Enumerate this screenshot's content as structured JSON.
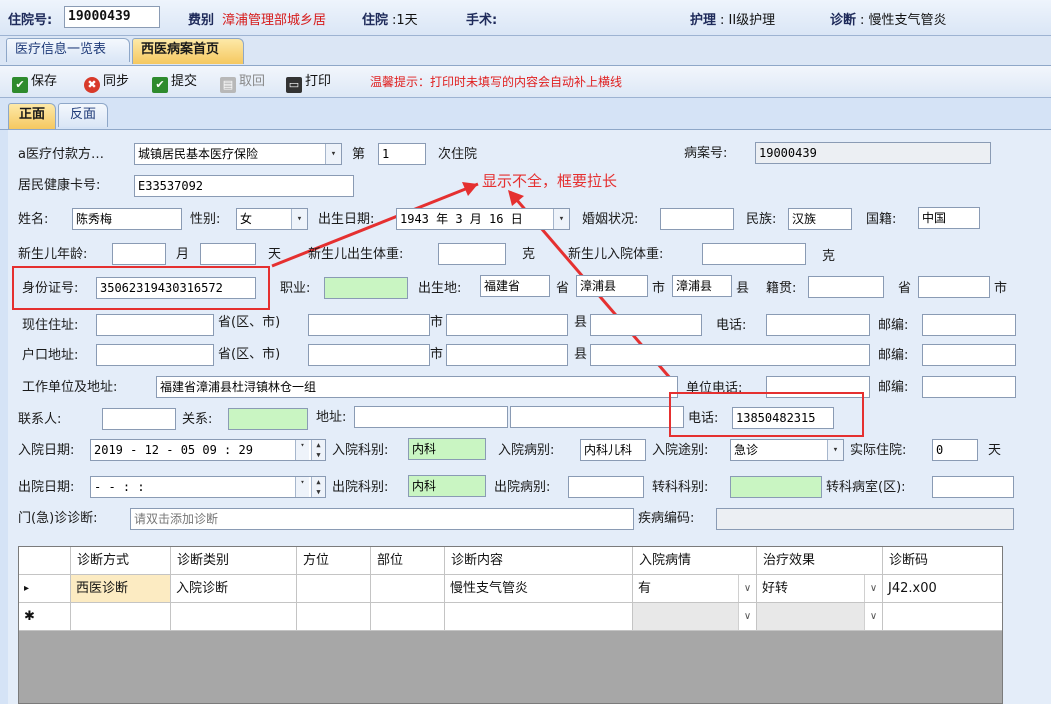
{
  "header": {
    "admission_label": "住院号:",
    "admission_no": "19000439",
    "category_label": "费别",
    "category_value": "漳浦管理部城乡居",
    "stay_label": "住院",
    "stay_value": ":1天",
    "surgery_label": "手术:",
    "nursing_label": "护理",
    "nursing_value": ": II级护理",
    "diagnosis_label": "诊断",
    "diagnosis_value": ": 慢性支气管炎"
  },
  "tabs": {
    "overview": "医疗信息一览表",
    "homepage": "西医病案首页"
  },
  "toolbar": {
    "save": "保存",
    "sync": "同步",
    "submit": "提交",
    "recall": "取回",
    "print": "打印",
    "tip": "温馨提示：打印时未填写的内容会自动补上横线"
  },
  "subtabs": {
    "front": "正面",
    "back": "反面"
  },
  "annotation": {
    "text": "显示不全，框要拉长",
    "color": "#e53030"
  },
  "form": {
    "payment_label": "a医疗付款方…",
    "payment_value": "城镇居民基本医疗保险",
    "nth_label": "第",
    "nth_value": "1",
    "nth_suffix": "次住院",
    "record_label": "病案号:",
    "record_value": "19000439",
    "health_card_label": "居民健康卡号:",
    "health_card_value": "E33537092",
    "name_label": "姓名:",
    "name_value": "陈秀梅",
    "gender_label": "性别:",
    "gender_value": "女",
    "birth_label": "出生日期:",
    "birth_value": "1943 年 3 月 16 日",
    "marital_label": "婚姻状况:",
    "ethnic_label": "民族:",
    "ethnic_value": "汉族",
    "nationality_label": "国籍:",
    "nationality_value": "中国",
    "newborn_age_label": "新生儿年龄:",
    "month_label": "月",
    "day_label": "天",
    "newborn_birth_weight_label": "新生儿出生体重:",
    "gram1": "克",
    "newborn_admit_weight_label": "新生儿入院体重:",
    "gram2": "克",
    "id_label": "身份证号:",
    "id_value": "35062319430316572",
    "job_label": "职业:",
    "birthplace_label": "出生地:",
    "birthplace_province": "福建省",
    "province_word": "省",
    "birthplace_county": "漳浦县",
    "city_word": "市",
    "birthplace_county2": "漳浦县",
    "county_word": "县",
    "native_label": "籍贯:",
    "native_province_word": "省",
    "native_city_word": "市",
    "current_addr_label": "现住住址:",
    "prov_district": "省(区、市)",
    "city2": "市",
    "county2": "县",
    "phone_label": "电话:",
    "postcode_label": "邮编:",
    "hukou_label": "户口地址:",
    "prov_district2": "省(区、市)",
    "city3": "市",
    "county3": "县",
    "postcode_label2": "邮编:",
    "work_label": "工作单位及地址:",
    "work_value": "福建省漳浦县杜浔镇林仓一组",
    "work_phone_label": "单位电话:",
    "postcode_label3": "邮编:",
    "contact_label": "联系人:",
    "relation_label": "关系:",
    "address_label": "地址:",
    "contact_phone_label": "电话:",
    "contact_phone_value": "13850482315",
    "admit_date_label": "入院日期:",
    "admit_date_value": "2019 - 12 - 05   09 : 29",
    "admit_dept_label": "入院科别:",
    "admit_dept_value": "内科",
    "admit_ward_label": "入院病别:",
    "admit_ward_value": "内科儿科",
    "admit_route_label": "入院途别:",
    "admit_route_value": "急诊",
    "actual_stay_label": "实际住院:",
    "actual_stay_value": "0",
    "actual_stay_unit": "天",
    "discharge_date_label": "出院日期:",
    "discharge_date_value": " -   -       :   :",
    "discharge_dept_label": "出院科别:",
    "discharge_dept_value": "内科",
    "discharge_ward_label": "出院病别:",
    "transfer_dept_label": "转科科别:",
    "transfer_ward_label": "转科病室(区):",
    "outpatient_label": "门(急)诊诊断:",
    "outpatient_placeholder": "请双击添加诊断",
    "disease_code_label": "疾病编码:"
  },
  "grid": {
    "columns": [
      "诊断方式",
      "诊断类别",
      "方位",
      "部位",
      "诊断内容",
      "入院病情",
      "治疗效果",
      "诊断码"
    ],
    "rows": [
      {
        "marker": "▸",
        "cells": [
          "西医诊断",
          "入院诊断",
          "",
          "",
          "慢性支气管炎",
          "有",
          "好转",
          "J42.x00"
        ]
      },
      {
        "marker": "✱",
        "cells": [
          "",
          "",
          "",
          "",
          "",
          "",
          "",
          ""
        ]
      }
    ]
  }
}
